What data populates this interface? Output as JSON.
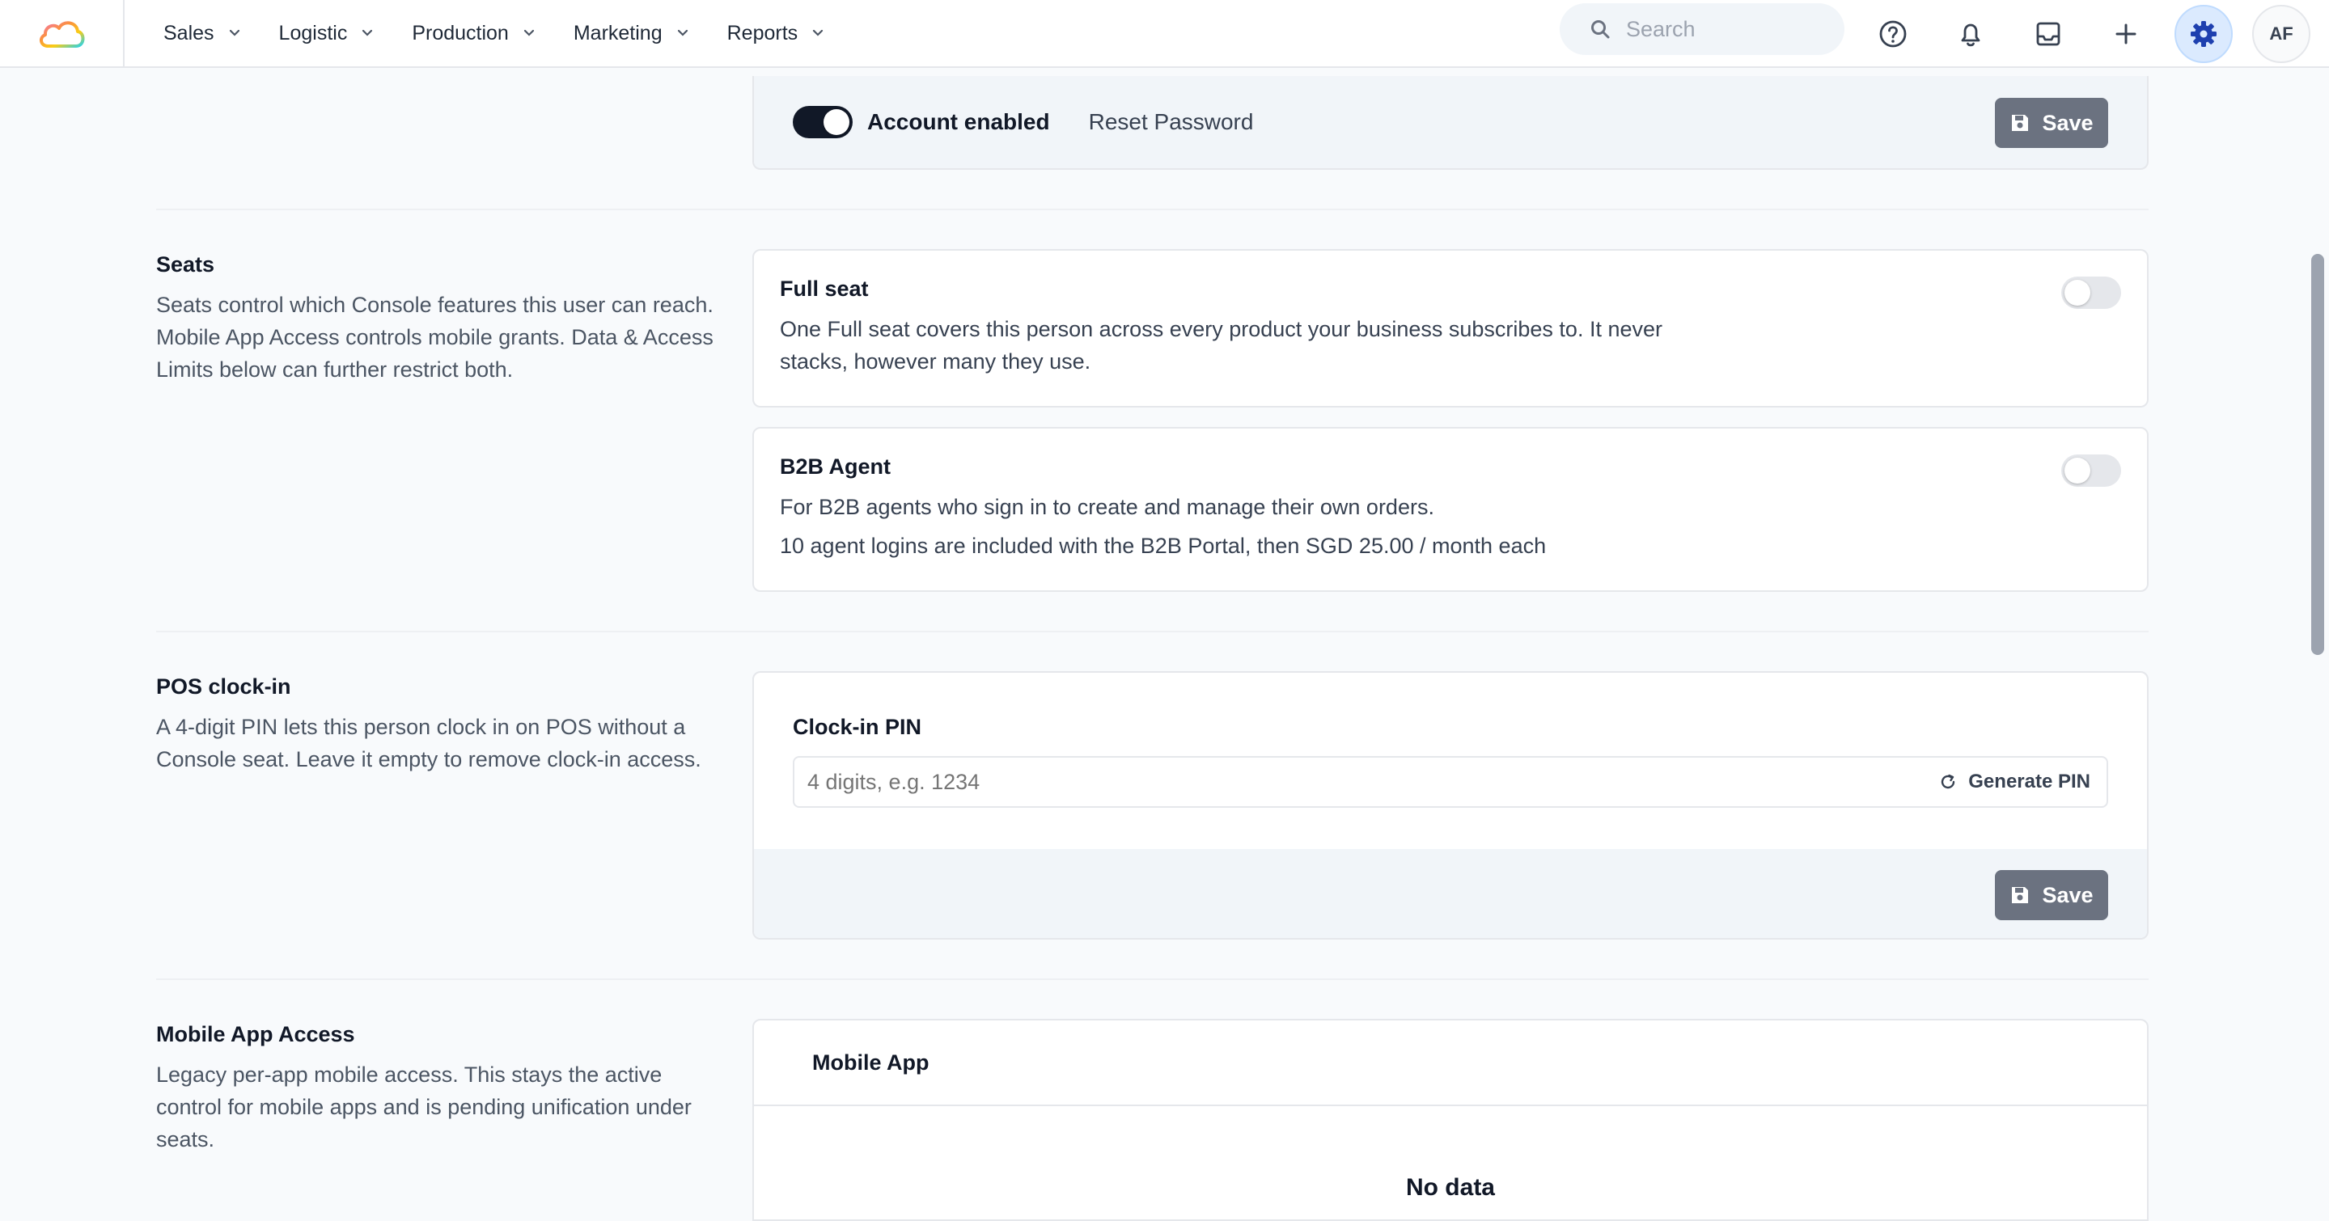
{
  "nav": {
    "items": [
      {
        "label": "Sales"
      },
      {
        "label": "Logistic"
      },
      {
        "label": "Production"
      },
      {
        "label": "Marketing"
      },
      {
        "label": "Reports"
      }
    ],
    "search_placeholder": "Search",
    "avatar_initials": "AF"
  },
  "account": {
    "enabled_label": "Account enabled",
    "enabled": true,
    "reset_password_label": "Reset Password",
    "save_label": "Save"
  },
  "seats": {
    "title": "Seats",
    "description": "Seats control which Console features this user can reach. Mobile App Access controls mobile grants. Data & Access Limits below can further restrict both.",
    "full_seat": {
      "title": "Full seat",
      "description": "One Full seat covers this person across every product your business subscribes to. It never stacks, however many they use.",
      "enabled": false
    },
    "b2b_agent": {
      "title": "B2B Agent",
      "description": "For B2B agents who sign in to create and manage their own orders.",
      "pricing": "10 agent logins are included with the B2B Portal, then SGD 25.00 / month each",
      "enabled": false
    }
  },
  "pos": {
    "title": "POS clock-in",
    "description": "A 4-digit PIN lets this person clock in on POS without a Console seat. Leave it empty to remove clock-in access.",
    "pin_label": "Clock-in PIN",
    "pin_value": "",
    "pin_placeholder": "4 digits, e.g. 1234",
    "generate_label": "Generate PIN",
    "save_label": "Save"
  },
  "mobile": {
    "title": "Mobile App Access",
    "description": "Legacy per-app mobile access. This stays the active control for mobile apps and is pending unification under seats.",
    "table_header": "Mobile App",
    "empty_text": "No data"
  },
  "colors": {
    "accent": "#2563eb",
    "toggle_on": "#111827",
    "save_button": "#6b7280"
  }
}
